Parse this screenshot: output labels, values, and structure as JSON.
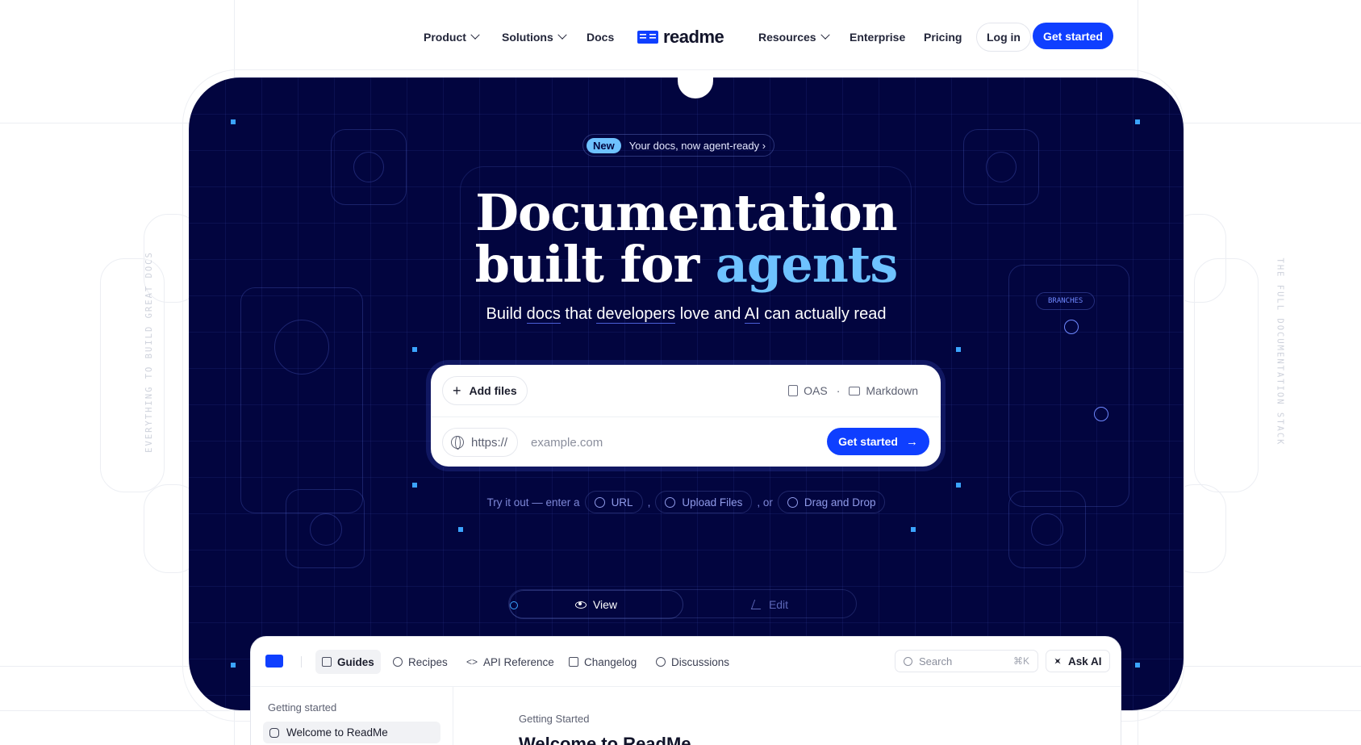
{
  "nav": {
    "product": "Product",
    "solutions": "Solutions",
    "docs": "Docs",
    "logo_text": "readme",
    "resources": "Resources",
    "enterprise": "Enterprise",
    "pricing": "Pricing",
    "login": "Log in",
    "get_started": "Get started"
  },
  "hero": {
    "pill_tag": "New",
    "pill_text": "Your docs, now agent-ready ›",
    "headline_line1": "Documentation",
    "headline_line2_prefix": "built for ",
    "headline_line2_accent": "agents",
    "subtitle_parts": [
      "Build ",
      "docs",
      " that ",
      "developers",
      " love and ",
      "AI",
      " can actually read"
    ],
    "side_left_caption": "EVERYTHING TO BUILD GREAT DOCS",
    "side_right_caption": "THE FULL DOCUMENTATION STACK",
    "branches_label": "BRANCHES"
  },
  "card": {
    "add_files": "Add files",
    "format_oas": "OAS",
    "format_sep": "·",
    "format_markdown": "Markdown",
    "protocol": "https://",
    "url_placeholder": "example.com",
    "submit": "Get started"
  },
  "tryit": {
    "prefix": "Try it out — enter a",
    "url": "URL",
    "comma": ",",
    "upload": "Upload Files",
    "or": ", or",
    "drag": "Drag and Drop"
  },
  "toggle": {
    "view": "View",
    "edit": "Edit"
  },
  "app": {
    "tabs": [
      "Guides",
      "Recipes",
      "API Reference",
      "Changelog",
      "Discussions"
    ],
    "search_placeholder": "Search",
    "search_shortcut": "⌘K",
    "ask_ai": "Ask AI",
    "sidebar_heading": "Getting started",
    "sidebar_item": "Welcome to ReadMe",
    "breadcrumb": "Getting Started",
    "page_title": "Welcome to ReadMe"
  },
  "colors": {
    "hero_bg": "#02053f",
    "accent": "#6ec2ff",
    "primary": "#0f3fff"
  }
}
